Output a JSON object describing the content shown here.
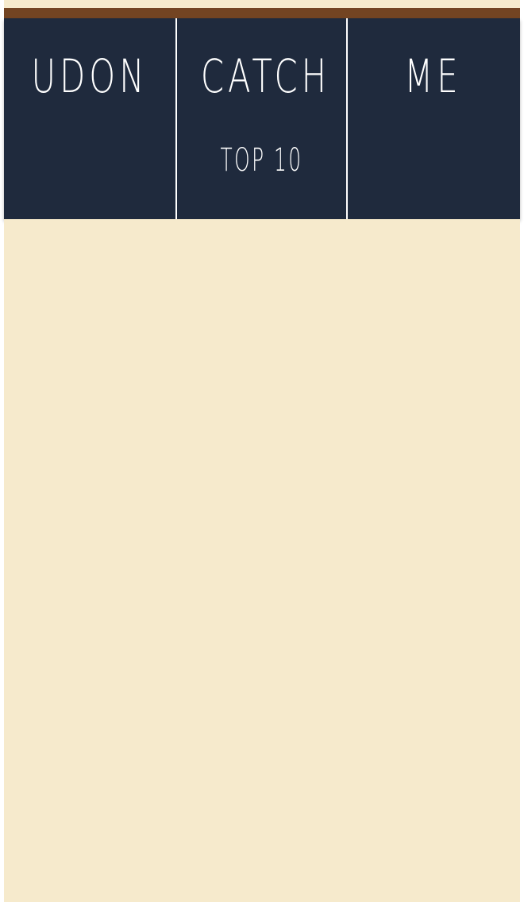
{
  "colors": {
    "background": "#f6eacc",
    "accent_bar": "#734422",
    "nav_bg": "#1f2a3d",
    "nav_text": "#ffffff",
    "page_outer": "#ffffff"
  },
  "nav": {
    "tabs": [
      {
        "label": "UDON",
        "sub": ""
      },
      {
        "label": "CATCH",
        "sub": "TOP 10"
      },
      {
        "label": "ME",
        "sub": ""
      }
    ]
  }
}
